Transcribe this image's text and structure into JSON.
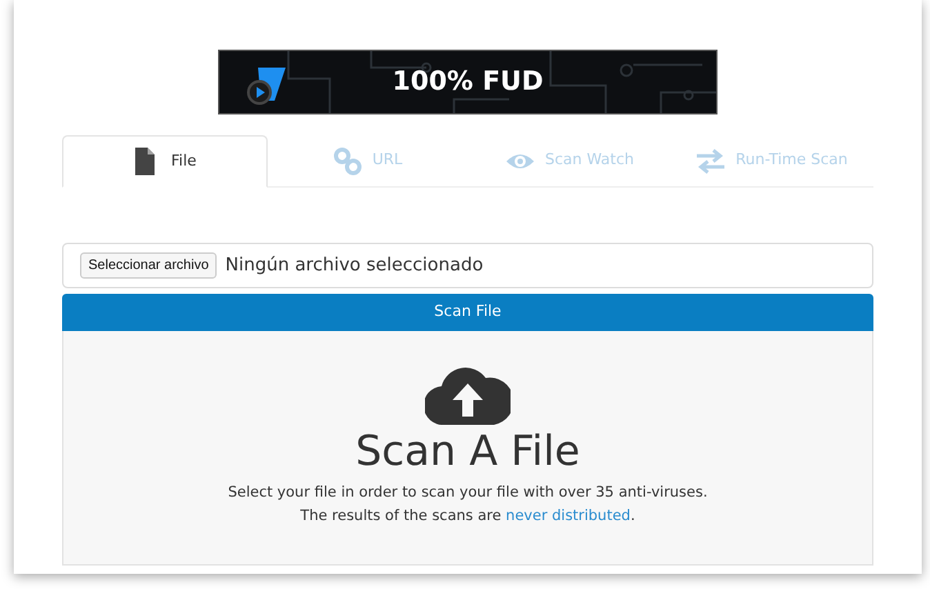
{
  "banner": {
    "text": "100% FUD"
  },
  "tabs": [
    {
      "label": "File",
      "kind": "file",
      "selected": true
    },
    {
      "label": "URL",
      "kind": "link",
      "selected": false
    },
    {
      "label": "Scan Watch",
      "kind": "eye",
      "selected": false
    },
    {
      "label": "Run-Time Scan",
      "kind": "arrows",
      "selected": false
    }
  ],
  "file_input": {
    "button": "Seleccionar archivo",
    "status": "Ningún archivo seleccionado"
  },
  "scan_button": "Scan File",
  "dropzone": {
    "title": "Scan A File",
    "description": "Select your file in order to scan your file with over 35 anti-viruses.",
    "note_before": "The results of the scans are ",
    "note_link": "never distributed",
    "note_after": "."
  }
}
